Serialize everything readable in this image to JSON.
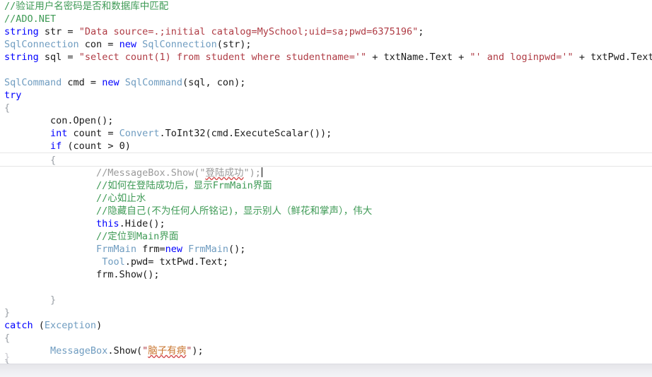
{
  "editor": {
    "language": "csharp",
    "caret_line_index": 12,
    "colors": {
      "keyword": "#0000FF",
      "type": "#6F9CC0",
      "string": "#AF3B44",
      "comment": "#3E9A55",
      "comment_disabled": "#9A9A9A",
      "text": "#1A1A1A",
      "background": "#FFFFFF",
      "current_line_border": "#E6E6E6",
      "squiggle": "#D34B4B",
      "status_bar": "#E4E4E9"
    },
    "clipped_last_brace": "}"
  },
  "lines": [
    {
      "indent": 0,
      "tokens": [
        {
          "t": "cmt",
          "s": "//验证用户名密码是否和数据库中匹配"
        }
      ]
    },
    {
      "indent": 0,
      "tokens": [
        {
          "t": "cmt",
          "s": "//ADO.NET"
        }
      ]
    },
    {
      "indent": 0,
      "tokens": [
        {
          "t": "kw",
          "s": "string"
        },
        {
          "t": "plain",
          "s": " str = "
        },
        {
          "t": "str",
          "s": "\"Data source=.;initial catalog=MySchool;uid=sa;pwd=6375196\""
        },
        {
          "t": "plain",
          "s": ";"
        }
      ]
    },
    {
      "indent": 0,
      "tokens": [
        {
          "t": "type",
          "s": "SqlConnection"
        },
        {
          "t": "plain",
          "s": " con = "
        },
        {
          "t": "kw",
          "s": "new"
        },
        {
          "t": "plain",
          "s": " "
        },
        {
          "t": "type",
          "s": "SqlConnection"
        },
        {
          "t": "plain",
          "s": "(str);"
        }
      ]
    },
    {
      "indent": 0,
      "tokens": [
        {
          "t": "kw",
          "s": "string"
        },
        {
          "t": "plain",
          "s": " sql = "
        },
        {
          "t": "str",
          "s": "\"select count(1) from student where studentname='\""
        },
        {
          "t": "plain",
          "s": " + txtName.Text + "
        },
        {
          "t": "str",
          "s": "\"' and loginpwd='\""
        },
        {
          "t": "plain",
          "s": " + txtPwd.Text + "
        },
        {
          "t": "str",
          "s": "\"'\""
        },
        {
          "t": "plain",
          "s": ";"
        }
      ]
    },
    {
      "indent": 0,
      "tokens": [
        {
          "t": "plain",
          "s": ""
        }
      ]
    },
    {
      "indent": 0,
      "tokens": [
        {
          "t": "type",
          "s": "SqlCommand"
        },
        {
          "t": "plain",
          "s": " cmd = "
        },
        {
          "t": "kw",
          "s": "new"
        },
        {
          "t": "plain",
          "s": " "
        },
        {
          "t": "type",
          "s": "SqlCommand"
        },
        {
          "t": "plain",
          "s": "(sql, con);"
        }
      ]
    },
    {
      "indent": 0,
      "tokens": [
        {
          "t": "kw",
          "s": "try"
        }
      ]
    },
    {
      "indent": 0,
      "tokens": [
        {
          "t": "brace",
          "s": "{"
        }
      ]
    },
    {
      "indent": 1,
      "tokens": [
        {
          "t": "plain",
          "s": "con.Open();"
        }
      ]
    },
    {
      "indent": 1,
      "tokens": [
        {
          "t": "kw",
          "s": "int"
        },
        {
          "t": "plain",
          "s": " count = "
        },
        {
          "t": "type",
          "s": "Convert"
        },
        {
          "t": "plain",
          "s": ".ToInt32(cmd.ExecuteScalar());"
        }
      ]
    },
    {
      "indent": 1,
      "tokens": [
        {
          "t": "kw",
          "s": "if"
        },
        {
          "t": "plain",
          "s": " (count > 0)"
        }
      ]
    },
    {
      "indent": 1,
      "tokens": [
        {
          "t": "brace",
          "s": "{"
        }
      ],
      "current": true
    },
    {
      "indent": 2,
      "tokens": [
        {
          "t": "cmt-dim",
          "s": "//MessageBox.Show(\""
        },
        {
          "t": "squig",
          "s": "登陆成功"
        },
        {
          "t": "cmt-dim",
          "s": "\");"
        }
      ],
      "caret": true
    },
    {
      "indent": 2,
      "tokens": [
        {
          "t": "cmt",
          "s": "//如何在登陆成功后，显示FrmMain界面"
        }
      ]
    },
    {
      "indent": 2,
      "tokens": [
        {
          "t": "cmt",
          "s": "//心如止水"
        }
      ]
    },
    {
      "indent": 2,
      "tokens": [
        {
          "t": "cmt",
          "s": "//隐藏自己(不为任何人所铭记)，显示别人（鲜花和掌声），伟大"
        }
      ]
    },
    {
      "indent": 2,
      "tokens": [
        {
          "t": "kw",
          "s": "this"
        },
        {
          "t": "plain",
          "s": ".Hide();"
        }
      ]
    },
    {
      "indent": 2,
      "tokens": [
        {
          "t": "cmt",
          "s": "//定位到Main界面"
        }
      ]
    },
    {
      "indent": 2,
      "tokens": [
        {
          "t": "type",
          "s": "FrmMain"
        },
        {
          "t": "plain",
          "s": " frm="
        },
        {
          "t": "kw",
          "s": "new"
        },
        {
          "t": "plain",
          "s": " "
        },
        {
          "t": "type",
          "s": "FrmMain"
        },
        {
          "t": "plain",
          "s": "();"
        }
      ]
    },
    {
      "indent": 2,
      "tokens": [
        {
          "t": "plain",
          "s": " "
        },
        {
          "t": "type",
          "s": "Tool"
        },
        {
          "t": "plain",
          "s": ".pwd= txtPwd.Text;"
        }
      ]
    },
    {
      "indent": 2,
      "tokens": [
        {
          "t": "plain",
          "s": "frm.Show();"
        }
      ]
    },
    {
      "indent": 0,
      "tokens": [
        {
          "t": "plain",
          "s": ""
        }
      ]
    },
    {
      "indent": 1,
      "tokens": [
        {
          "t": "brace",
          "s": "}"
        }
      ]
    },
    {
      "indent": 0,
      "tokens": [
        {
          "t": "brace",
          "s": "}"
        }
      ]
    },
    {
      "indent": 0,
      "tokens": [
        {
          "t": "kw",
          "s": "catch"
        },
        {
          "t": "plain",
          "s": " ("
        },
        {
          "t": "type",
          "s": "Exception"
        },
        {
          "t": "plain",
          "s": ")"
        }
      ]
    },
    {
      "indent": 0,
      "tokens": [
        {
          "t": "brace",
          "s": "{"
        }
      ]
    },
    {
      "indent": 1,
      "tokens": [
        {
          "t": "type",
          "s": "MessageBox"
        },
        {
          "t": "plain",
          "s": ".Show("
        },
        {
          "t": "str",
          "s": "\""
        },
        {
          "t": "squig-red",
          "s": "脑子有病"
        },
        {
          "t": "str",
          "s": "\""
        },
        {
          "t": "plain",
          "s": ");"
        }
      ]
    },
    {
      "indent": 0,
      "tokens": [
        {
          "t": "brace",
          "s": "}"
        }
      ]
    }
  ]
}
